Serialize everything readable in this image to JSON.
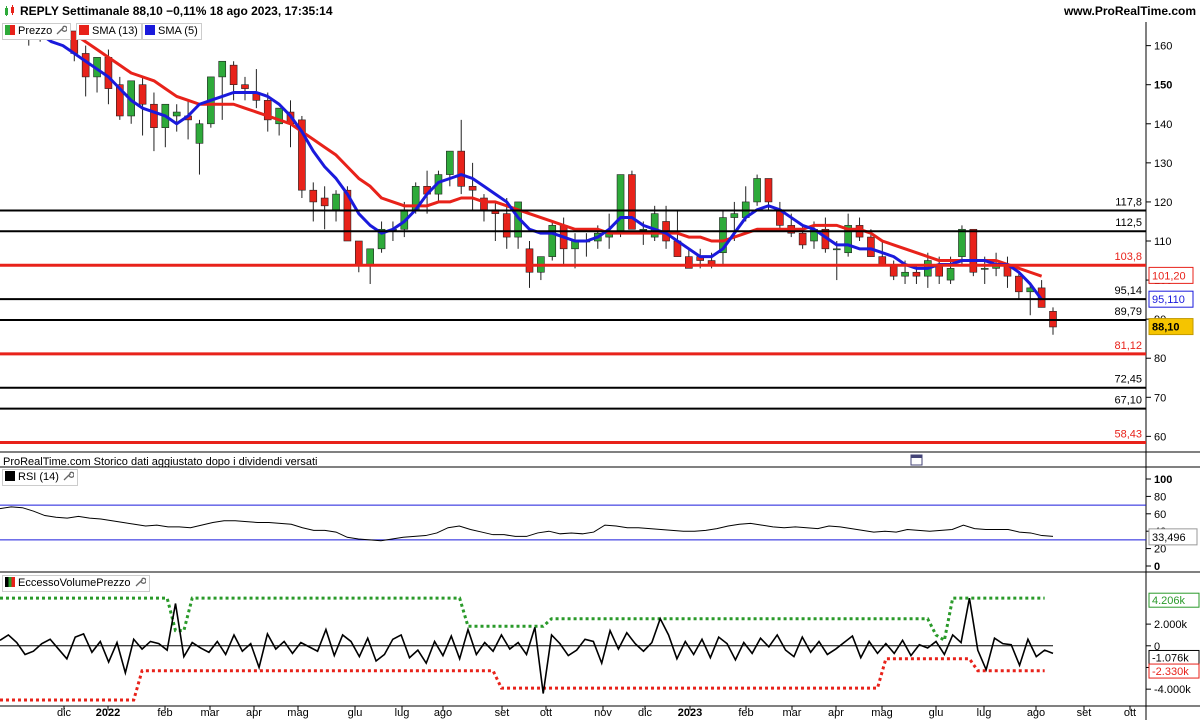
{
  "header": {
    "title": "REPLY Settimanale 88,10 −0,11% 18 ago 2023, 17:35:14",
    "site": "www.ProRealTime.com"
  },
  "legend": {
    "price_label": "Prezzo",
    "sma13_label": "SMA (13)",
    "sma5_label": "SMA (5)",
    "rsi_label": "RSI (14)",
    "vol_label": "EccessoVolumePrezzo"
  },
  "note": "ProRealTime.com Storico dati aggiustato dopo i dividendi versati",
  "colors": {
    "up": "#2eaa3a",
    "down": "#e8221a",
    "sma13": "#e8221a",
    "sma5": "#1a1adc",
    "level_black": "#000000",
    "level_red": "#e8221a",
    "green_dot": "#2a9a2a",
    "red_dot": "#e8221a",
    "price_badge": "#f5c400"
  },
  "chart_data": [
    {
      "type": "candlestick",
      "title": "REPLY Settimanale",
      "y_ticks": [
        60,
        70,
        80,
        90,
        100,
        110,
        120,
        130,
        140,
        150,
        160
      ],
      "ylim": [
        56,
        164
      ],
      "x_labels": [
        "dic",
        "2022",
        "feb",
        "mar",
        "apr",
        "mag",
        "giu",
        "lug",
        "ago",
        "set",
        "ott",
        "nov",
        "dic",
        "2023",
        "feb",
        "mar",
        "apr",
        "mag",
        "giu",
        "lug",
        "ago",
        "set",
        "ott"
      ],
      "levels": [
        {
          "value": 117.8,
          "label": "117,8",
          "color": "black"
        },
        {
          "value": 112.5,
          "label": "112,5",
          "color": "black"
        },
        {
          "value": 103.8,
          "label": "103,8",
          "color": "red"
        },
        {
          "value": 95.14,
          "label": "95,14",
          "color": "black"
        },
        {
          "value": 89.79,
          "label": "89,79",
          "color": "black"
        },
        {
          "value": 81.12,
          "label": "81,12",
          "color": "red"
        },
        {
          "value": 72.45,
          "label": "72,45",
          "color": "black"
        },
        {
          "value": 67.1,
          "label": "67,10",
          "color": "black"
        },
        {
          "value": 58.43,
          "label": "58,43",
          "color": "red"
        }
      ],
      "last_values": {
        "sma13": "101,20",
        "sma5": "95,110",
        "price": "88,10"
      },
      "candles": [
        [
          178,
          180,
          172,
          175
        ],
        [
          173,
          176,
          164,
          166
        ],
        [
          166,
          170,
          160,
          162
        ],
        [
          162,
          168,
          161,
          166
        ],
        [
          166,
          171,
          164,
          169
        ],
        [
          168,
          170,
          163,
          165
        ],
        [
          164,
          166,
          156,
          158
        ],
        [
          158,
          160,
          147,
          152
        ],
        [
          152,
          157,
          148,
          157
        ],
        [
          157,
          159,
          145,
          149
        ],
        [
          150,
          152,
          141,
          142
        ],
        [
          142,
          151,
          140,
          151
        ],
        [
          150,
          152,
          137,
          145
        ],
        [
          145,
          148,
          133,
          139
        ],
        [
          139,
          145,
          134,
          145
        ],
        [
          142,
          145,
          138,
          143
        ],
        [
          142,
          146,
          136,
          141
        ],
        [
          135,
          141,
          127,
          140
        ],
        [
          140,
          152,
          139,
          152
        ],
        [
          152,
          156,
          141,
          156
        ],
        [
          155,
          156,
          146,
          150
        ],
        [
          150,
          152,
          146,
          149
        ],
        [
          148,
          154,
          144,
          146
        ],
        [
          146,
          148,
          138,
          141
        ],
        [
          140,
          144,
          137,
          144
        ],
        [
          143,
          146,
          134,
          140
        ],
        [
          141,
          142,
          121,
          123
        ],
        [
          123,
          125,
          115,
          120
        ],
        [
          121,
          124,
          113,
          119
        ],
        [
          118,
          123,
          115,
          122
        ],
        [
          123,
          124,
          110,
          110
        ],
        [
          110,
          110,
          102,
          104
        ],
        [
          104,
          108,
          99,
          108
        ],
        [
          108,
          115,
          107,
          113
        ],
        [
          113,
          115,
          110,
          113
        ],
        [
          113,
          120,
          111,
          118
        ],
        [
          118,
          125,
          117,
          124
        ],
        [
          124,
          128,
          117,
          122
        ],
        [
          122,
          128,
          120,
          127
        ],
        [
          127,
          133,
          124,
          133
        ],
        [
          133,
          141,
          122,
          124
        ],
        [
          124,
          130,
          118,
          123
        ],
        [
          121,
          122,
          115,
          118
        ],
        [
          118,
          120,
          110,
          117
        ],
        [
          117,
          121,
          108,
          111
        ],
        [
          111,
          120,
          108,
          120
        ],
        [
          108,
          110,
          98,
          102
        ],
        [
          102,
          106,
          100,
          106
        ],
        [
          106,
          115,
          105,
          114
        ],
        [
          114,
          116,
          104,
          108
        ],
        [
          108,
          112,
          103,
          110
        ],
        [
          110,
          112,
          106,
          110
        ],
        [
          110,
          114,
          108,
          112
        ],
        [
          111,
          117,
          108,
          112
        ],
        [
          112,
          127,
          111,
          127
        ],
        [
          127,
          128,
          113,
          113
        ],
        [
          113,
          115,
          109,
          113
        ],
        [
          111,
          119,
          110,
          117
        ],
        [
          115,
          119,
          108,
          110
        ],
        [
          110,
          118,
          106,
          106
        ],
        [
          106,
          108,
          103,
          103
        ],
        [
          106,
          108,
          103,
          105
        ],
        [
          105,
          107,
          103,
          104
        ],
        [
          107,
          118,
          104,
          116
        ],
        [
          116,
          120,
          110,
          117
        ],
        [
          116,
          124,
          115,
          120
        ],
        [
          120,
          127,
          119,
          126
        ],
        [
          126,
          126,
          118,
          120
        ],
        [
          118,
          120,
          113,
          114
        ],
        [
          114,
          117,
          111,
          112
        ],
        [
          112,
          114,
          108,
          109
        ],
        [
          110,
          115,
          108,
          113
        ],
        [
          113,
          116,
          107,
          108
        ],
        [
          108,
          110,
          100,
          108
        ],
        [
          107,
          117,
          106,
          114
        ],
        [
          114,
          116,
          110,
          111
        ],
        [
          111,
          113,
          106,
          106
        ],
        [
          106,
          110,
          104,
          104
        ],
        [
          104,
          105,
          100,
          101
        ],
        [
          101,
          105,
          99,
          102
        ],
        [
          102,
          104,
          99,
          101
        ],
        [
          101,
          107,
          98,
          105
        ],
        [
          104,
          106,
          99,
          101
        ],
        [
          100,
          106,
          99,
          103
        ],
        [
          106,
          114,
          104,
          113
        ],
        [
          113,
          113,
          101,
          102
        ],
        [
          103,
          106,
          99,
          103
        ],
        [
          103,
          107,
          101,
          104
        ],
        [
          104,
          106,
          98,
          101
        ],
        [
          101,
          102,
          95,
          97
        ],
        [
          97,
          99,
          91,
          98
        ],
        [
          98,
          100,
          93,
          93
        ],
        [
          92,
          93,
          86,
          88
        ]
      ],
      "sma5": [
        168,
        166,
        165,
        163,
        161,
        160,
        158,
        156,
        154,
        152,
        149,
        146,
        144,
        143,
        142,
        140,
        142,
        145,
        146,
        147,
        148,
        148,
        148,
        147,
        145,
        142,
        138,
        133,
        129,
        126,
        122,
        117,
        114,
        112,
        113,
        115,
        118,
        122,
        125,
        126,
        127,
        126,
        124,
        122,
        120,
        116,
        113,
        112,
        112,
        111,
        110,
        110,
        111,
        113,
        116,
        116,
        114,
        113,
        112,
        110,
        108,
        106,
        106,
        108,
        112,
        116,
        118,
        119,
        118,
        116,
        114,
        113,
        111,
        109,
        109,
        108,
        108,
        107,
        106,
        104,
        103,
        103,
        104,
        104,
        105,
        105,
        105,
        104,
        104,
        102,
        99,
        95
      ],
      "sma13": [
        170,
        169,
        168,
        167,
        166,
        165,
        163,
        161,
        159,
        157,
        155,
        153,
        152,
        151,
        149,
        147,
        146,
        145,
        145,
        145,
        145,
        144,
        143,
        142,
        141,
        140,
        138,
        136,
        134,
        132,
        129,
        126,
        124,
        121,
        120,
        119,
        119,
        119,
        120,
        120,
        121,
        121,
        120,
        120,
        119,
        118,
        117,
        116,
        115,
        114,
        113,
        113,
        113,
        112,
        112,
        112,
        112,
        112,
        112,
        112,
        111,
        111,
        110,
        110,
        111,
        112,
        113,
        113,
        113,
        113,
        113,
        114,
        114,
        114,
        113,
        113,
        112,
        110,
        109,
        108,
        107,
        106,
        105,
        105,
        105,
        105,
        105,
        105,
        104,
        103,
        102,
        101
      ]
    },
    {
      "type": "line",
      "title": "RSI (14)",
      "y_ticks": [
        0,
        20,
        40,
        60,
        80,
        100
      ],
      "ylim": [
        0,
        100
      ],
      "bands": [
        70,
        30
      ],
      "last_value": "33,496",
      "values": [
        66,
        68,
        67,
        63,
        58,
        56,
        55,
        57,
        55,
        54,
        52,
        50,
        48,
        46,
        47,
        45,
        45,
        44,
        47,
        50,
        52,
        52,
        51,
        50,
        50,
        49,
        48,
        44,
        41,
        41,
        39,
        33,
        31,
        30,
        29,
        31,
        33,
        34,
        35,
        38,
        44,
        46,
        42,
        39,
        36,
        36,
        34,
        34,
        38,
        40,
        37,
        38,
        37,
        39,
        47,
        46,
        44,
        44,
        43,
        42,
        41,
        40,
        40,
        41,
        43,
        46,
        48,
        49,
        47,
        45,
        44,
        45,
        44,
        43,
        46,
        45,
        43,
        41,
        39,
        40,
        39,
        42,
        41,
        40,
        41,
        42,
        47,
        43,
        42,
        42,
        42,
        39,
        38,
        35,
        34
      ]
    },
    {
      "type": "line",
      "title": "EccessoVolumePrezzo",
      "y_ticks": [
        -4000,
        -2000,
        0,
        2000
      ],
      "y_tick_labels": [
        "-4.000k",
        "",
        "0",
        "2.000k"
      ],
      "ylim": [
        -5000,
        5700
      ],
      "last_values": {
        "upper": "4.206k",
        "main": "-1.076k",
        "lower": "-2.330k"
      },
      "main": [
        500,
        1000,
        300,
        -800,
        -500,
        200,
        600,
        -300,
        -1200,
        800,
        1100,
        -600,
        400,
        -1500,
        300,
        -2500,
        600,
        -300,
        400,
        200,
        -400,
        3900,
        -1000,
        300,
        -200,
        -600,
        400,
        -800,
        1000,
        -500,
        200,
        -2000,
        1100,
        -300,
        400,
        -700,
        300,
        -100,
        -500,
        1500,
        -900,
        1000,
        400,
        -1000,
        700,
        -1400,
        -800,
        600,
        1000,
        -1100,
        -400,
        -1600,
        400,
        -900,
        900,
        -1200,
        1500,
        -800,
        300,
        -500,
        1000,
        -300,
        300,
        -800,
        1700,
        -4400,
        1000,
        200,
        -900,
        -400,
        600,
        400,
        -1600,
        1400,
        -300,
        1200,
        200,
        -500,
        300,
        2500,
        1000,
        -1200,
        400,
        -800,
        600,
        -1100,
        800,
        200,
        -1300,
        300,
        -700,
        700,
        -100,
        1000,
        -400,
        -1000,
        800,
        -600,
        400,
        -800,
        -300,
        300,
        900,
        -1100,
        400,
        -700,
        200,
        -700,
        500,
        -900,
        100,
        -200,
        400,
        -800,
        1000,
        300,
        4400,
        -400,
        -2200,
        700,
        200,
        100,
        -1800,
        600,
        -1000,
        -400,
        -700
      ],
      "upper": [
        4400,
        4400,
        4400,
        4400,
        4400,
        4400,
        4400,
        4400,
        4400,
        4400,
        4400,
        4400,
        4400,
        4400,
        4400,
        4400,
        4400,
        4400,
        4400,
        4400,
        4400,
        1400,
        1400,
        4400,
        4400,
        4400,
        4400,
        4400,
        4400,
        4400,
        4400,
        4400,
        4400,
        4400,
        4400,
        4400,
        4400,
        4400,
        4400,
        4400,
        4400,
        4400,
        4400,
        4400,
        4400,
        4400,
        4400,
        4400,
        4400,
        4400,
        4400,
        4400,
        4400,
        4400,
        4400,
        4400,
        1800,
        1800,
        1800,
        1800,
        1800,
        1800,
        1800,
        1800,
        1800,
        1800,
        2500,
        2500,
        2500,
        2500,
        2500,
        2500,
        2500,
        2500,
        2500,
        2500,
        2500,
        2500,
        2500,
        2500,
        2500,
        2500,
        2500,
        2500,
        2500,
        2500,
        2500,
        2500,
        2500,
        2500,
        2500,
        2500,
        2500,
        2500,
        2500,
        2500,
        2500,
        2500,
        2500,
        2500,
        2500,
        2500,
        2500,
        2500,
        2500,
        2500,
        2500,
        2500,
        2500,
        2500,
        2500,
        2500,
        1000,
        500,
        4400,
        4400,
        4400,
        4400,
        4400,
        4400,
        4400,
        4400,
        4400,
        4400,
        4400,
        4400
      ],
      "lower": [
        -5000,
        -5000,
        -5000,
        -5000,
        -5000,
        -5000,
        -5000,
        -5000,
        -5000,
        -5000,
        -5000,
        -5000,
        -5000,
        -5000,
        -5000,
        -5000,
        -5000,
        -2300,
        -2300,
        -2300,
        -2300,
        -2300,
        -2300,
        -2300,
        -2300,
        -2300,
        -2300,
        -2300,
        -2300,
        -2300,
        -2300,
        -2300,
        -2300,
        -2300,
        -2300,
        -2300,
        -2300,
        -2300,
        -2300,
        -2300,
        -2300,
        -2300,
        -2300,
        -2300,
        -2300,
        -2300,
        -2300,
        -2300,
        -2300,
        -2300,
        -2300,
        -2300,
        -2300,
        -2300,
        -2300,
        -2300,
        -2300,
        -2300,
        -2300,
        -2300,
        -3900,
        -3900,
        -3900,
        -3900,
        -3900,
        -3900,
        -3900,
        -3900,
        -3900,
        -3900,
        -3900,
        -3900,
        -3900,
        -3900,
        -3900,
        -3900,
        -3900,
        -3900,
        -3900,
        -3900,
        -3900,
        -3900,
        -3900,
        -3900,
        -3900,
        -3900,
        -3900,
        -3900,
        -3900,
        -3900,
        -3900,
        -3900,
        -3900,
        -3900,
        -3900,
        -3900,
        -3900,
        -3900,
        -3900,
        -3900,
        -3900,
        -3900,
        -3900,
        -3900,
        -3900,
        -3900,
        -1200,
        -1200,
        -1200,
        -1200,
        -1200,
        -1200,
        -1200,
        -1200,
        -1200,
        -1200,
        -1200,
        -2300,
        -2300,
        -2300,
        -2300,
        -2300,
        -2300,
        -2300,
        -2300,
        -2300
      ]
    }
  ]
}
